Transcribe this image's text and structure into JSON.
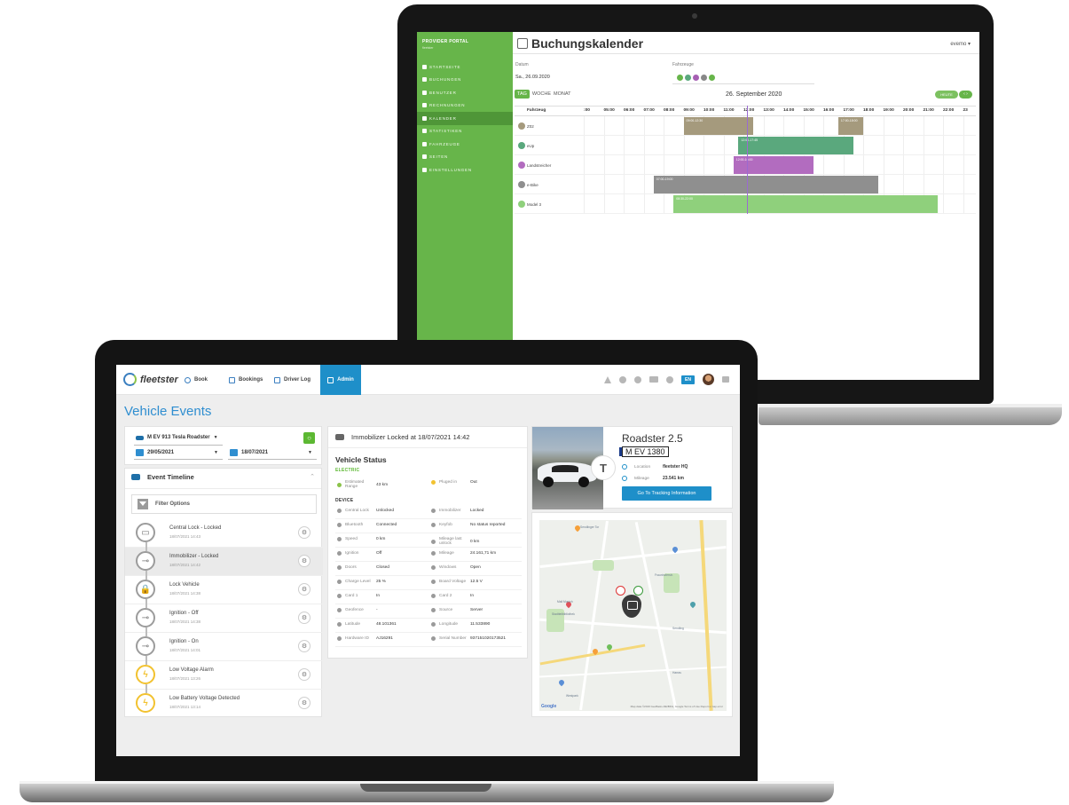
{
  "back_app": {
    "brand": "PROVIDER PORTAL",
    "brand_sub": "fleetster",
    "nav": [
      "STARTSEITE",
      "BUCHUNGEN",
      "BENUTZER",
      "RECHNUNGEN",
      "KALENDER",
      "STATISTIKEN",
      "FAHRZEUGE",
      "SEITEN",
      "EINSTELLUNGEN"
    ],
    "active_nav": "KALENDER",
    "title": "Buchungskalender",
    "user": "evemo ▾",
    "date_label": "Datum",
    "date_value": "Sa., 26.09.2020",
    "vehicles_label": "Fahrzeuge",
    "views": [
      "TAG",
      "WOCHE",
      "MONAT"
    ],
    "active_view": "TAG",
    "current_date": "26. September 2020",
    "today_button": "HEUTE",
    "grid_header": "Fahrzeug",
    "hours": [
      ":00",
      "05:00",
      "06:00",
      "07:00",
      "08:00",
      "09:00",
      "10:00",
      "11:00",
      "12:00",
      "13:00",
      "14:00",
      "15:00",
      "16:00",
      "17:00",
      "18:00",
      "19:00",
      "20:00",
      "21:00",
      "22:00",
      "23"
    ],
    "vehicles": [
      {
        "name": "Z02",
        "color": "#a59a7d"
      },
      {
        "name": "eUp",
        "color": "#5aa87d"
      },
      {
        "name": "Landstreicher",
        "color": "#b26cbf"
      },
      {
        "name": "e-Bike",
        "color": "#8f8f8f"
      },
      {
        "name": "Model 3",
        "color": "#8fd07c"
      }
    ],
    "bookings": [
      {
        "row": 0,
        "start": 9.0,
        "end": 12.5,
        "label": "09:00-12:30",
        "color": "#a59a7d"
      },
      {
        "row": 0,
        "start": 16.75,
        "end": 18.0,
        "label": "17:00-18:00",
        "color": "#a59a7d"
      },
      {
        "row": 1,
        "start": 11.75,
        "end": 17.5,
        "label": "12:00-17:45",
        "color": "#5aa87d"
      },
      {
        "row": 2,
        "start": 11.5,
        "end": 15.5,
        "label": "12:00-16:00",
        "color": "#b26cbf"
      },
      {
        "row": 3,
        "start": 7.5,
        "end": 18.75,
        "label": "07:00-19:00",
        "color": "#8f8f8f"
      },
      {
        "row": 4,
        "start": 8.5,
        "end": 21.75,
        "label": "08:30-22:00",
        "color": "#8fd07c"
      }
    ]
  },
  "app": {
    "logo": "fleetster",
    "nav": {
      "book": "Book",
      "bookings": "Bookings",
      "driver_log": "Driver Log",
      "admin": "Admin"
    },
    "lang": "EN",
    "page_title": "Vehicle Events",
    "vehicle_select": "M EV 913 Tesla Roadster",
    "date_from": "29/05/2021",
    "date_to": "18/07/2021",
    "timeline_title": "Event Timeline",
    "filter_label": "Filter Options",
    "events": [
      {
        "title": "Central Lock - Locked",
        "date": "18/07/2021 14:43",
        "icon": "car-door-icon",
        "warn": false,
        "selected": false
      },
      {
        "title": "Immobilizer - Locked",
        "date": "18/07/2021 14:42",
        "icon": "key-icon",
        "warn": false,
        "selected": true
      },
      {
        "title": "Lock Vehicle",
        "date": "18/07/2021 14:38",
        "icon": "lock-icon",
        "warn": false,
        "selected": false
      },
      {
        "title": "Ignition - Off",
        "date": "18/07/2021 14:38",
        "icon": "key-icon",
        "warn": false,
        "selected": false
      },
      {
        "title": "Ignition - On",
        "date": "18/07/2021 14:01",
        "icon": "key-icon",
        "warn": false,
        "selected": false
      },
      {
        "title": "Low Voltage Alarm",
        "date": "18/07/2021 13:26",
        "icon": "lightning-icon",
        "warn": true,
        "selected": false
      },
      {
        "title": "Low Battery Voltage Detected",
        "date": "18/07/2021 13:14",
        "icon": "lightning-icon",
        "warn": true,
        "selected": false
      }
    ],
    "detail_header": "Immobilizer Locked at 18/07/2021 14:42",
    "vehicle_status_title": "Vehicle Status",
    "section_electric": "ELECTRIC",
    "section_device": "DEVICE",
    "electric": [
      {
        "label": "Estimated Range",
        "value": "43 km"
      },
      {
        "label": "Pluged in",
        "value": "Out"
      }
    ],
    "device": [
      [
        "Central Lock",
        "Unlocked",
        "Immobilizer",
        "Locked"
      ],
      [
        "Bluetooth",
        "Connected",
        "Keyfob",
        "No status reported"
      ],
      [
        "Speed",
        "0 km",
        "Mileage last unlock",
        "0 km"
      ],
      [
        "Ignition",
        "Off",
        "Mileage",
        "24.161,71 km"
      ],
      [
        "Doors",
        "Closed",
        "Windows",
        "Open"
      ],
      [
        "Charge Level",
        "25 %",
        "Board Voltage",
        "12.5 V"
      ],
      [
        "Card 1",
        "In",
        "Card 2",
        "In"
      ],
      [
        "Geofence",
        "-",
        "Source",
        "Server"
      ],
      [
        "Latitude",
        "48.101361",
        "Longitude",
        "11.533890"
      ],
      [
        "Hardware ID",
        "AJ16291",
        "Serial Number",
        "937151020173521"
      ]
    ],
    "vehicle_name": "Roadster 2.5",
    "plate": "M EV 1380",
    "location_label": "Location",
    "location_value": "fleetster HQ",
    "mileage_label": "Mileage",
    "mileage_value": "23.541 km",
    "tracking_button": "Go To Tracking Information",
    "map_google": "Google",
    "map_attrib": "Map data ©2019 GeoBasis-DE/BKG, Google   Terms of Use   Report a map error",
    "map_places": [
      "Sendlinger Tor",
      "Mall Munich",
      "Stadtteilbibliothek",
      "Sendling",
      "Harras",
      "Westpark",
      "Fraunhoferstr."
    ]
  }
}
